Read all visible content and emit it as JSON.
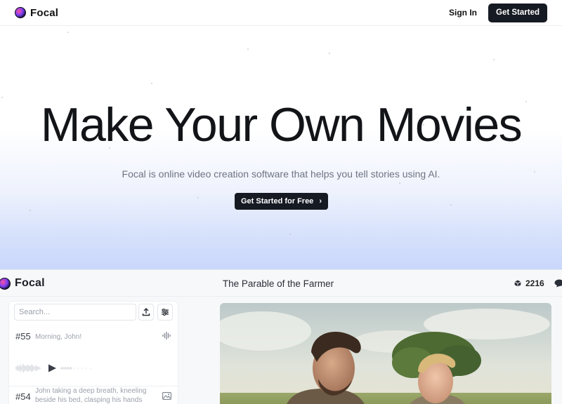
{
  "nav": {
    "brand": "Focal",
    "sign_in": "Sign In",
    "get_started": "Get Started"
  },
  "hero": {
    "title": "Make Your Own Movies",
    "subtitle": "Focal is online video creation software that helps you tell stories using AI.",
    "cta": "Get Started for Free"
  },
  "app": {
    "brand": "Focal",
    "project_title": "The Parable of the Farmer",
    "credits": "2216",
    "search_placeholder": "Search...",
    "items": [
      {
        "number": "#55",
        "text": "Morning, John!",
        "type_icon": "waveform-icon"
      },
      {
        "number": "#54",
        "text": "John taking a deep breath, kneeling beside his bed, clasping his hands together. K",
        "type_icon": "image-icon"
      }
    ]
  },
  "colors": {
    "dark_button": "#161a23",
    "hero_gradient_bottom": "#c9d7fb"
  }
}
